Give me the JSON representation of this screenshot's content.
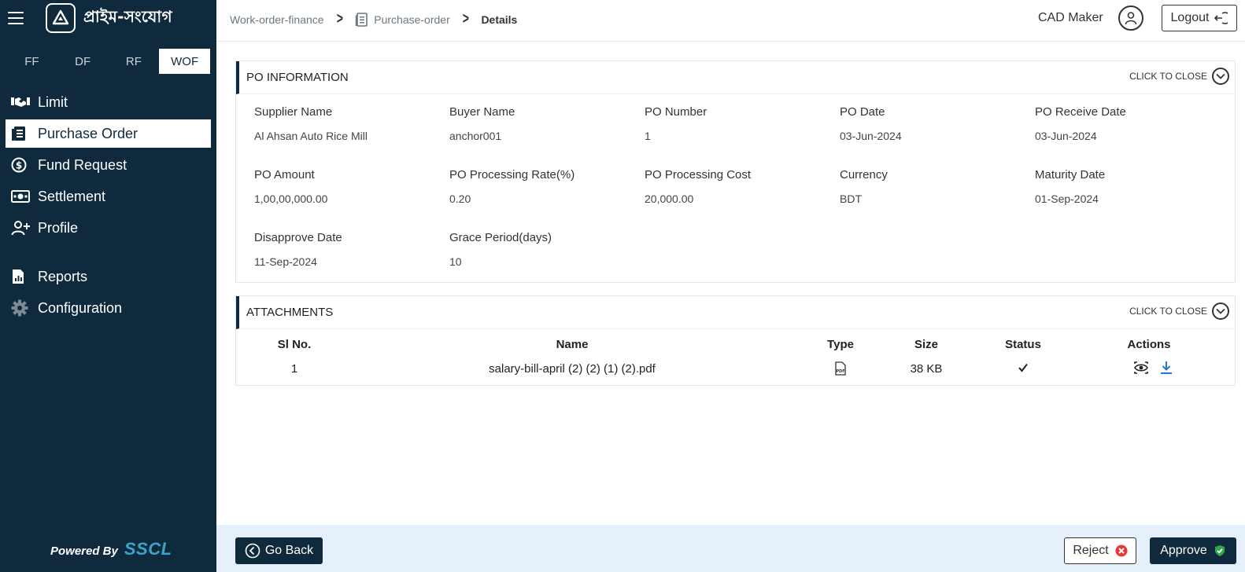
{
  "sidebar": {
    "logo_text": "প্রাইম-সংযোগ",
    "tabs": [
      "FF",
      "DF",
      "RF",
      "WOF"
    ],
    "active_tab": "WOF",
    "menu": [
      {
        "label": "Limit",
        "icon": "handshake-icon"
      },
      {
        "label": "Purchase Order",
        "icon": "document-list-icon",
        "active": true
      },
      {
        "label": "Fund Request",
        "icon": "currency-circle-icon"
      },
      {
        "label": "Settlement",
        "icon": "banknote-icon"
      },
      {
        "label": "Profile",
        "icon": "user-add-icon"
      },
      {
        "label": "Reports",
        "icon": "report-file-icon"
      },
      {
        "label": "Configuration",
        "icon": "gear-icon"
      }
    ],
    "powered_by": "Powered By",
    "brand": "SSCL"
  },
  "header": {
    "breadcrumb": [
      "Work-order-finance",
      "Purchase-order",
      "Details"
    ],
    "user_name": "CAD Maker",
    "logout_label": "Logout"
  },
  "po_info": {
    "title": "PO INFORMATION",
    "toggle_label": "CLICK TO CLOSE",
    "fields": [
      {
        "label": "Supplier Name",
        "value": "Al Ahsan Auto Rice Mill"
      },
      {
        "label": "Buyer Name",
        "value": "anchor001"
      },
      {
        "label": "PO Number",
        "value": "1"
      },
      {
        "label": "PO Date",
        "value": "03-Jun-2024"
      },
      {
        "label": "PO Receive Date",
        "value": "03-Jun-2024"
      },
      {
        "label": "PO Amount",
        "value": "1,00,00,000.00"
      },
      {
        "label": "PO Processing Rate(%)",
        "value": "0.20"
      },
      {
        "label": "PO Processing Cost",
        "value": "20,000.00"
      },
      {
        "label": "Currency",
        "value": "BDT"
      },
      {
        "label": "Maturity Date",
        "value": "01-Sep-2024"
      },
      {
        "label": "Disapprove Date",
        "value": "11-Sep-2024"
      },
      {
        "label": "Grace Period(days)",
        "value": "10"
      }
    ]
  },
  "attachments": {
    "title": "ATTACHMENTS",
    "toggle_label": "CLICK TO CLOSE",
    "columns": [
      "Sl No.",
      "Name",
      "Type",
      "Size",
      "Status",
      "Actions"
    ],
    "rows": [
      {
        "sl": "1",
        "name": "salary-bill-april (2) (2) (1) (2).pdf",
        "type_icon": "pdf-file-icon",
        "size": "38 KB",
        "status_icon": "checkmark-icon",
        "actions": [
          "view-icon",
          "download-icon"
        ]
      }
    ]
  },
  "footer": {
    "go_back_label": "Go Back",
    "reject_label": "Reject",
    "approve_label": "Approve"
  },
  "colors": {
    "sidebar_bg": "#0f2a3d",
    "footer_bg": "#e5f0fb",
    "brand_accent": "#3ba4c8",
    "reject_red": "#e53935",
    "approve_green": "#2eaa4a",
    "download_blue": "#1f78d1"
  }
}
